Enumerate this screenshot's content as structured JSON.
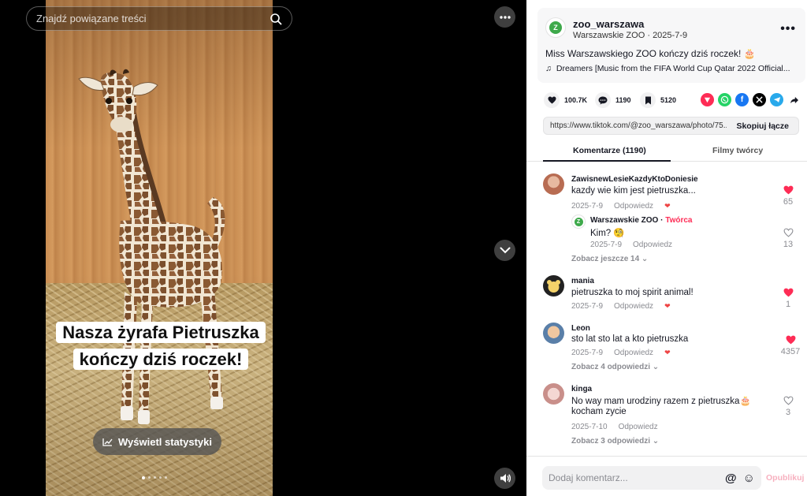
{
  "viewer": {
    "search_placeholder": "Znajdź powiązane treści",
    "caption_line1": "Nasza żyrafa Pietruszka",
    "caption_line2": "kończy dziś roczek!",
    "stats_button": "Wyświetl statystyki",
    "icons": [
      "search-icon",
      "more-icon",
      "chevron-down-icon",
      "volume-icon",
      "chart-icon"
    ]
  },
  "post": {
    "username": "zoo_warszawa",
    "display_name": "Warszawskie ZOO",
    "date": "2025-7-9",
    "description": "Miss Warszawskiego ZOO kończy dziś roczek! 🎂",
    "music": "Dreamers [Music from the FIFA World Cup Qatar 2022 Official..."
  },
  "actions": {
    "likes": "100.7K",
    "comments": "1190",
    "saves": "5120"
  },
  "share": {
    "url": "https://www.tiktok.com/@zoo_warszawa/photo/75...",
    "copy_label": "Skopiuj łącze"
  },
  "tabs": {
    "comments": "Komentarze (1190)",
    "creator_videos": "Filmy twórcy"
  },
  "comments": [
    {
      "user": "ZawisnewLesieKazdyKtoDoniesie",
      "text": "kazdy wie kim jest pietruszka...",
      "date": "2025-7-9",
      "reply": "Odpowiedz",
      "likes": "65",
      "liked": true
    },
    {
      "user": "Warszawskie ZOO",
      "creator_tag": "Twórca",
      "text": "Kim? 🧐",
      "date": "2025-7-9",
      "reply": "Odpowiedz",
      "likes": "13",
      "liked": false
    },
    {
      "user": "mania",
      "text": "pietruszka to moj spirit animal!",
      "date": "2025-7-9",
      "reply": "Odpowiedz",
      "likes": "1",
      "liked": true
    },
    {
      "user": "Leon",
      "text": "sto lat sto lat a kto pietruszka",
      "date": "2025-7-9",
      "reply": "Odpowiedz",
      "likes": "4357",
      "liked": true
    },
    {
      "user": "kinga",
      "text": "No way mam urodziny razem z pietruszka🎂",
      "text2": "kocham zycie",
      "date": "2025-7-10",
      "reply": "Odpowiedz",
      "likes": "3",
      "liked": false
    }
  ],
  "more_replies": {
    "first": "Zobacz jeszcze 14",
    "leon": "Zobacz 4 odpowiedzi",
    "kinga": "Zobacz 3 odpowiedzi"
  },
  "composer": {
    "placeholder": "Dodaj komentarz...",
    "publish": "Opublikuj"
  },
  "colors": {
    "accent": "#fe2c55",
    "liked_heart": "#fe2c55"
  }
}
